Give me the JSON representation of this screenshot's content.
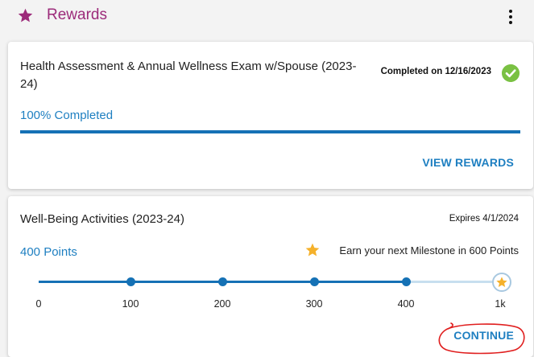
{
  "header": {
    "icon": "star-icon",
    "title": "Rewards",
    "menu_icon": "more-vertical-icon",
    "accent_color": "#9c2b7a"
  },
  "assessment_card": {
    "title": "Health Assessment & Annual Wellness Exam w/Spouse (2023-24)",
    "completed_text": "Completed on 12/16/2023",
    "status_icon": "check-circle-icon",
    "progress_label": "100% Completed",
    "progress_fraction": 1.0,
    "action_label": "VIEW REWARDS"
  },
  "activities_card": {
    "title": "Well-Being Activities (2023-24)",
    "expires_text": "Expires 4/1/2024",
    "points_label": "400 Points",
    "milestone_icon": "star-icon",
    "milestone_text": "Earn your next Milestone in 600 Points",
    "progress_value": 400,
    "progress_max": 1000,
    "milestones": [
      100,
      200,
      300,
      400
    ],
    "goal_icon": "star-icon",
    "tick_labels": [
      "0",
      "100",
      "200",
      "300",
      "400",
      "1k"
    ],
    "action_label": "CONTINUE"
  },
  "colors": {
    "link": "#1e7fc1",
    "progress": "#1571b5",
    "success": "#7ac143",
    "star": "#f5b12b",
    "annotation": "#e01e1e"
  }
}
